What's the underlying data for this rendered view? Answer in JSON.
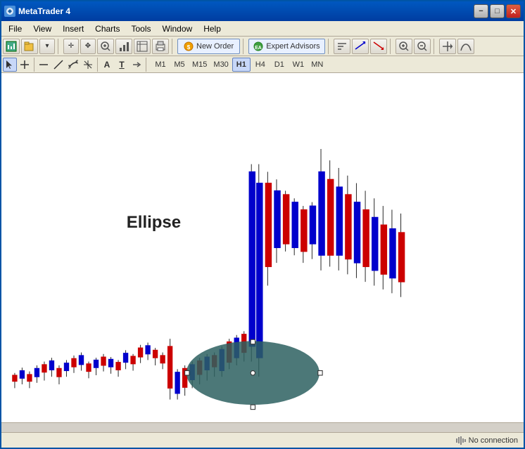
{
  "window": {
    "title": "MetaTrader 4"
  },
  "titlebar": {
    "title": "MetaTrader 4",
    "minimize_label": "−",
    "maximize_label": "□",
    "close_label": "✕"
  },
  "menubar": {
    "items": [
      {
        "label": "File",
        "id": "file"
      },
      {
        "label": "View",
        "id": "view"
      },
      {
        "label": "Insert",
        "id": "insert"
      },
      {
        "label": "Charts",
        "id": "charts"
      },
      {
        "label": "Tools",
        "id": "tools"
      },
      {
        "label": "Window",
        "id": "window"
      },
      {
        "label": "Help",
        "id": "help"
      }
    ]
  },
  "toolbar1": {
    "new_order_label": "New Order",
    "expert_advisors_label": "Expert Advisors"
  },
  "toolbar2": {
    "timeframes": [
      "M1",
      "M5",
      "M15",
      "M30",
      "H1",
      "H4",
      "D1",
      "W1",
      "MN"
    ]
  },
  "chart": {
    "ellipse_label": "Ellipse",
    "ellipse_color": "#2d6060"
  },
  "statusbar": {
    "connection_status": "No connection"
  }
}
